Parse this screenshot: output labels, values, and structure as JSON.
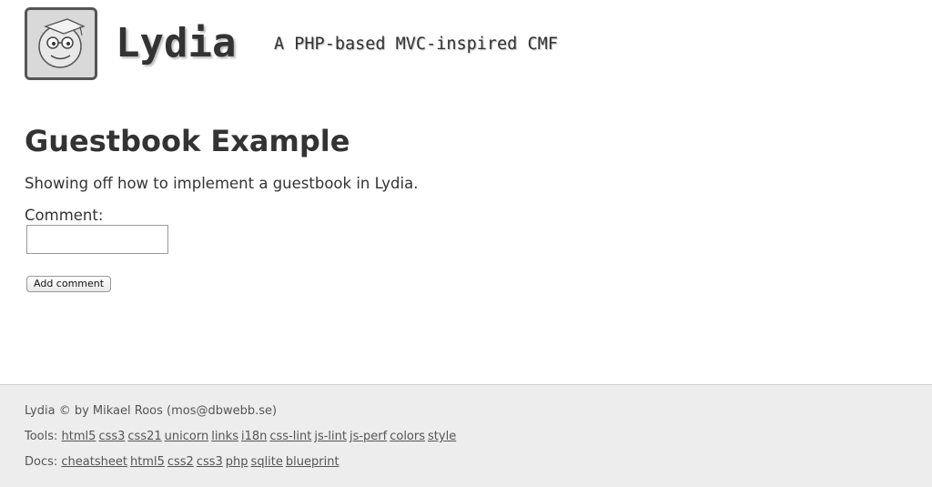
{
  "header": {
    "site_title": "Lydia",
    "slogan": "A PHP-based MVC-inspired CMF",
    "logo_icon": "student-face-logo-icon"
  },
  "main": {
    "title": "Guestbook Example",
    "intro": "Showing off how to implement a guestbook in Lydia.",
    "comment_label": "Comment:",
    "comment_value": "",
    "add_button": "Add comment"
  },
  "footer": {
    "copyright": "Lydia © by Mikael Roos (mos@dbwebb.se)",
    "tools_label": "Tools:",
    "tools": [
      "html5",
      "css3",
      "css21",
      "unicorn",
      "links",
      "i18n",
      "css-lint",
      "js-lint",
      "js-perf",
      "colors",
      "style"
    ],
    "docs_label": "Docs:",
    "docs": [
      "cheatsheet",
      "html5",
      "css2",
      "css3",
      "php",
      "sqlite",
      "blueprint"
    ]
  },
  "colors": {
    "text": "#333333",
    "footer_bg": "#ededed",
    "footer_text": "#555555",
    "background": "#ffffff"
  }
}
